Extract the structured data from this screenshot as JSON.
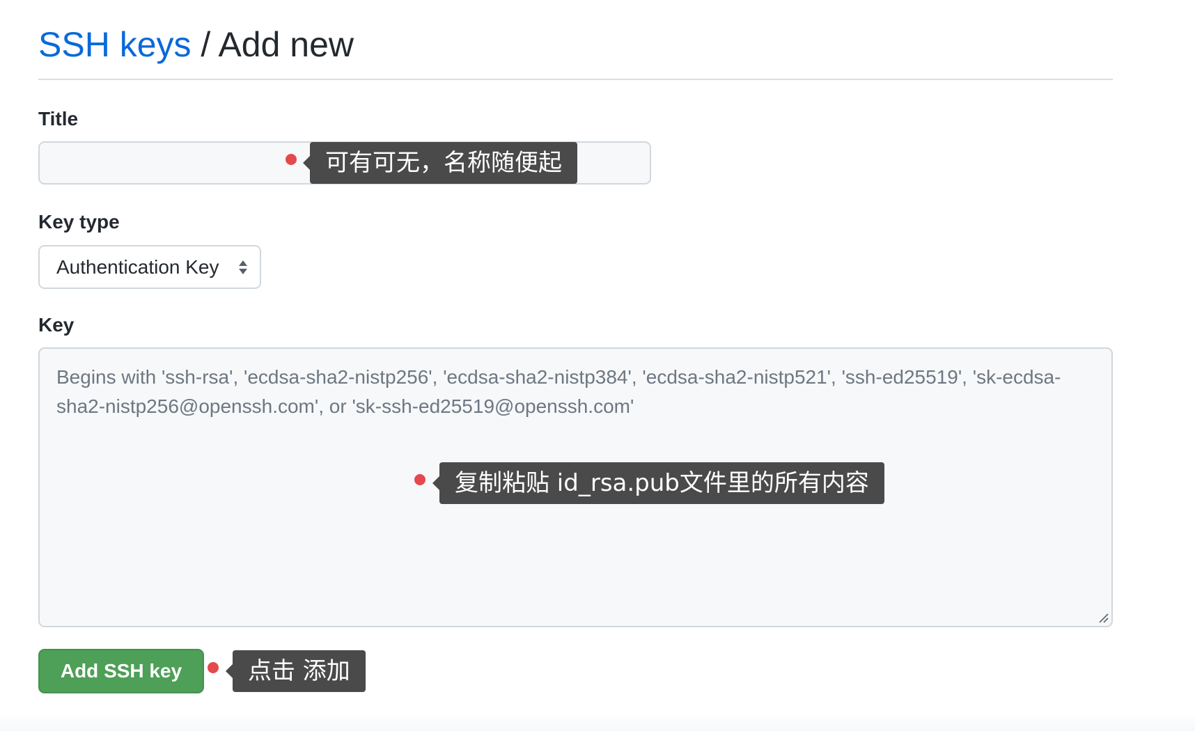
{
  "header": {
    "link_label": "SSH keys",
    "separator": " / ",
    "current": "Add new"
  },
  "form": {
    "title_label": "Title",
    "title_value": "",
    "key_type_label": "Key type",
    "key_type_selected": "Authentication Key",
    "key_label": "Key",
    "key_value": "",
    "key_placeholder": "Begins with 'ssh-rsa', 'ecdsa-sha2-nistp256', 'ecdsa-sha2-nistp384', 'ecdsa-sha2-nistp521', 'ssh-ed25519', 'sk-ecdsa-sha2-nistp256@openssh.com', or 'sk-ssh-ed25519@openssh.com'",
    "submit_label": "Add SSH key"
  },
  "annotations": {
    "title_note": "可有可无，名称随便起",
    "key_note": "复制粘贴 id_rsa.pub文件里的所有内容",
    "button_note": "点击 添加"
  },
  "icons": {
    "select_arrows": "select-arrows-icon",
    "resize_handle": "resize-handle-icon"
  },
  "colors": {
    "link": "#0969da",
    "button": "#4e9f57",
    "annotation_bg": "#4a4a4a",
    "annotation_dot": "#e5484d"
  }
}
